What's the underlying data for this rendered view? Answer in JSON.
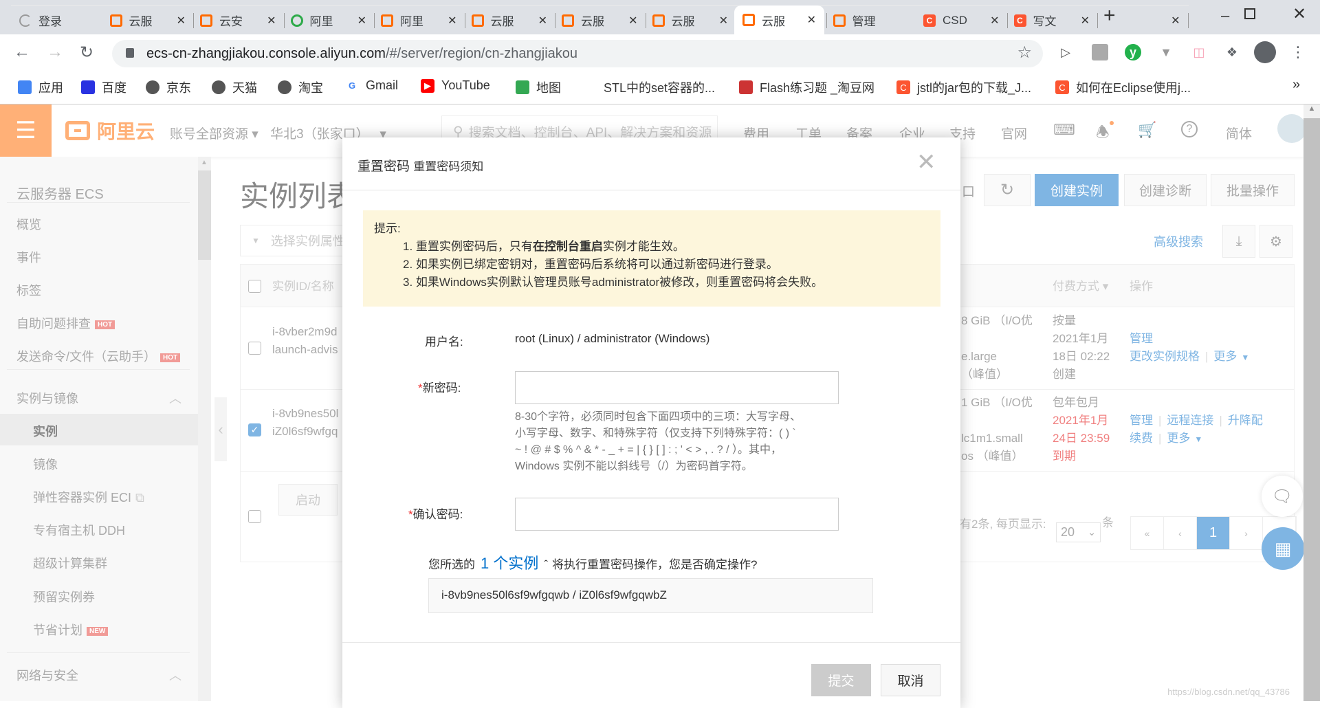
{
  "browser": {
    "tabs": [
      {
        "title": "登录",
        "icon": "loading"
      },
      {
        "title": "云服",
        "icon": "aliyun"
      },
      {
        "title": "云安",
        "icon": "aliyun"
      },
      {
        "title": "阿里",
        "icon": "green-o"
      },
      {
        "title": "阿里",
        "icon": "aliyun"
      },
      {
        "title": "云服",
        "icon": "aliyun"
      },
      {
        "title": "云服",
        "icon": "aliyun"
      },
      {
        "title": "云服",
        "icon": "aliyun"
      },
      {
        "title": "云服",
        "icon": "aliyun",
        "active": true
      },
      {
        "title": "管理",
        "icon": "aliyun"
      },
      {
        "title": "CSD",
        "icon": "csdn"
      },
      {
        "title": "写文",
        "icon": "csdn"
      }
    ],
    "new_tab": "+",
    "url_host": "ecs-cn-zhangjiakou.console.aliyun.com",
    "url_path": "/#/server/region/cn-zhangjiakou",
    "bookmarks": [
      {
        "label": "应用",
        "icon": "apps"
      },
      {
        "label": "百度",
        "icon": "baidu"
      },
      {
        "label": "京东",
        "icon": "globe"
      },
      {
        "label": "天猫",
        "icon": "globe"
      },
      {
        "label": "淘宝",
        "icon": "globe"
      },
      {
        "label": "Gmail",
        "icon": "google"
      },
      {
        "label": "YouTube",
        "icon": "youtube"
      },
      {
        "label": "地图",
        "icon": "maps"
      },
      {
        "label": "STL中的set容器的...",
        "icon": "stl"
      },
      {
        "label": "Flash练习题 _淘豆网",
        "icon": "taodou"
      },
      {
        "label": "jstl的jar包的下载_J...",
        "icon": "csdn"
      },
      {
        "label": "如何在Eclipse使用j...",
        "icon": "csdn"
      }
    ],
    "more": "»"
  },
  "header": {
    "logo": "阿里云",
    "account": "账号全部资源",
    "region": "华北3（张家口）",
    "search_placeholder": "搜索文档、控制台、API、解决方案和资源",
    "nav": [
      "费用",
      "工单",
      "备案",
      "企业",
      "支持",
      "官网"
    ],
    "lang": "简体"
  },
  "sidebar": {
    "title": "云服务器 ECS",
    "items": [
      {
        "label": "概览"
      },
      {
        "label": "事件"
      },
      {
        "label": "标签"
      },
      {
        "label": "自助问题排查",
        "badge": "HOT"
      },
      {
        "label": "发送命令/文件（云助手）",
        "badge": "HOT"
      }
    ],
    "group1": "实例与镜像",
    "sub": [
      {
        "label": "实例",
        "selected": true
      },
      {
        "label": "镜像"
      },
      {
        "label": "弹性容器实例 ECI"
      },
      {
        "label": "专有宿主机 DDH"
      },
      {
        "label": "超级计算集群"
      },
      {
        "label": "预留实例券"
      },
      {
        "label": "节省计划",
        "badge": "NEW"
      }
    ],
    "group2": "网络与安全"
  },
  "main": {
    "title": "实例列表",
    "partial_toolbar_char": "口",
    "create": "创建实例",
    "diagnose": "创建诊断",
    "batch": "批量操作",
    "filter_placeholder": "选择实例属性",
    "advanced_search": "高级搜索",
    "columns": {
      "id": "实例ID/名称",
      "payment": "付费方式",
      "actions": "操作"
    },
    "rows": [
      {
        "checked": false,
        "id": "i-8vber2m9d",
        "name": "launch-advis",
        "spec1": "8 GiB （I/O优",
        "spec2": "e.large",
        "spec3": "（峰值）",
        "pay": [
          "按量",
          "2021年1月",
          "18日 02:22",
          "创建"
        ],
        "pay_red": false,
        "actions": [
          [
            "管理"
          ],
          [
            "更改实例规格",
            "更多"
          ]
        ]
      },
      {
        "checked": true,
        "id": "i-8vb9nes50l",
        "name": "iZ0l6sf9wfgq",
        "spec1": "1 GiB （I/O优",
        "spec2": "lc1m1.small",
        "spec3": "os （峰值）",
        "pay": [
          "包年包月",
          "2021年1月",
          "24日 23:59",
          "到期"
        ],
        "pay_red": true,
        "actions": [
          [
            "管理",
            "远程连接",
            "升降配"
          ],
          [
            "续费",
            "更多"
          ]
        ]
      }
    ],
    "start_btn": "启动",
    "total": "有2条, 每页显示:",
    "page_size": "20",
    "unit": "条",
    "pages": [
      "«",
      "‹",
      "1",
      "›",
      "»"
    ],
    "current_page": 1
  },
  "dialog": {
    "title": "重置密码",
    "subtitle": "重置密码须知",
    "tip_title": "提示:",
    "tips": [
      {
        "pre": "1. 重置实例密码后，只有",
        "bold": "在控制台重启",
        "post": "实例才能生效。"
      },
      {
        "pre": "2. 如果实例已绑定密钥对，重置密码后系统将可以通过新密码进行登录。"
      },
      {
        "pre": "3. 如果Windows实例默认管理员账号administrator被修改，则重置密码将会失败。"
      }
    ],
    "username_label": "用户名:",
    "username_value": "root (Linux) / administrator (Windows)",
    "new_pwd_label": "新密码:",
    "confirm_pwd_label": "确认密码:",
    "required": "*",
    "hint": [
      "8-30个字符，必须同时包含下面四项中的三项：大写字母、",
      "小写字母、数字、和特殊字符（仅支持下列特殊字符：( ) `",
      "~ ! @ # $ % ^ & * - _ + = | { } [ ] : ; ' < > , . ? / ）。其中，",
      "Windows 实例不能以斜线号（/）为密码首字符。"
    ],
    "selected_pre": "您所选的",
    "selected_count": "1 个实例",
    "selected_post": "将执行重置密码操作，您是否确定操作?",
    "instance": "i-8vb9nes50l6sf9wfgqwb / iZ0l6sf9wfgqwbZ",
    "submit": "提交",
    "cancel": "取消"
  },
  "watermark": "https://blog.csdn.net/qq_43786",
  "colors": {
    "accent": "#0070cc",
    "aliyun_orange": "#ff6a00",
    "primary_btn": "#7fb5e3",
    "warn_bg": "#fdf6dc",
    "expire_red": "#f08080"
  }
}
